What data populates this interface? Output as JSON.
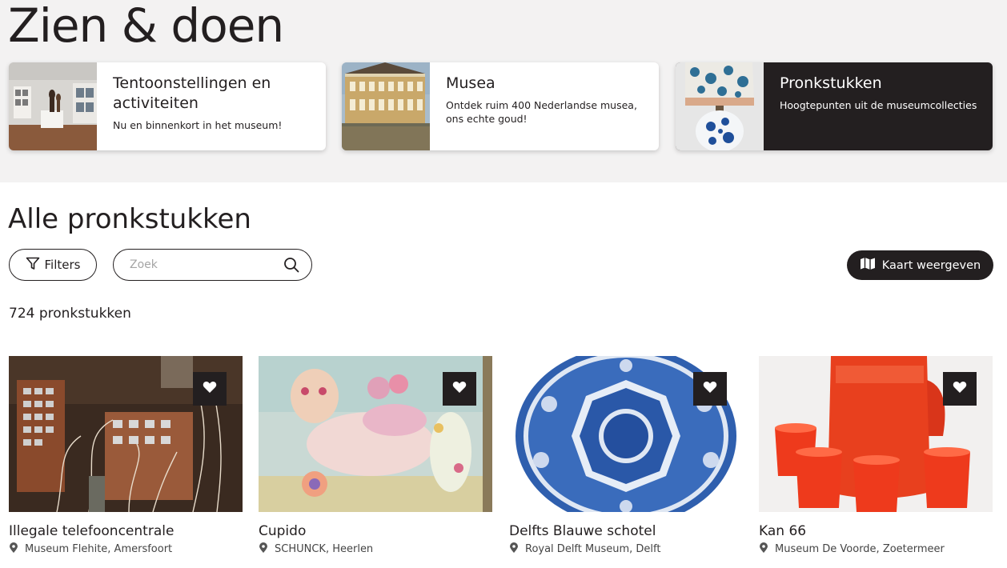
{
  "page": {
    "title": "Zien & doen"
  },
  "cards": [
    {
      "title": "Tentoonstellingen en activiteiten",
      "subtitle": "Nu en binnenkort in het museum!"
    },
    {
      "title": "Musea",
      "subtitle": "Ontdek ruim 400 Nederlandse musea, ons echte goud!"
    },
    {
      "title": "Pronkstukken",
      "subtitle": "Hoogtepunten uit de museumcollecties"
    }
  ],
  "section": {
    "title": "Alle pronkstukken",
    "filters_label": "Filters",
    "search_placeholder": "Zoek",
    "map_button_label": "Kaart weergeven",
    "count_label": "724 pronkstukken"
  },
  "items": [
    {
      "name": "Illegale telefooncentrale",
      "location": "Museum Flehite, Amersfoort"
    },
    {
      "name": "Cupido",
      "location": "SCHUNCK, Heerlen"
    },
    {
      "name": "Delfts Blauwe schotel",
      "location": "Royal Delft Museum, Delft"
    },
    {
      "name": "Kan 66",
      "location": "Museum De Voorde, Zoetermeer"
    }
  ],
  "icons": {
    "filter": "filter-icon",
    "search": "search-icon",
    "map": "map-icon",
    "favorite": "heart-icon",
    "location": "location-pin-icon"
  },
  "colors": {
    "dark": "#231f20",
    "top_background": "#f3f2f2"
  }
}
